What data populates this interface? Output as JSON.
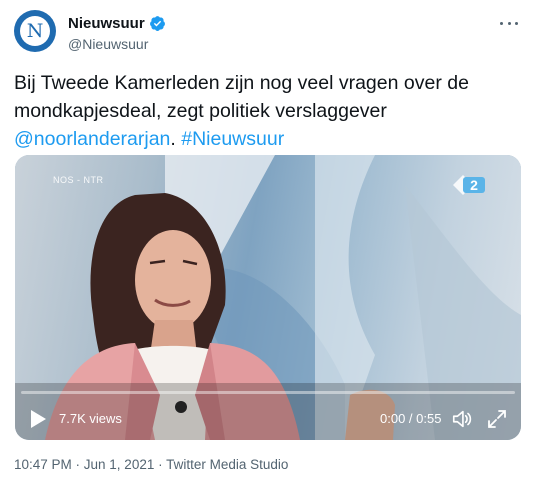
{
  "account": {
    "display_name": "Nieuwsuur",
    "handle": "@Nieuwsuur",
    "avatar_letter": "N",
    "verified": true
  },
  "tweet": {
    "text_plain": "Bij Tweede Kamerleden zijn nog veel vragen over de mondkapjesdeal, zegt politiek verslaggever ",
    "mention": "@noorlanderarjan",
    "separator": ". ",
    "hashtag": "#Nieuwsuur"
  },
  "video": {
    "channel_label": "NOS - NTR",
    "views": "7.7K views",
    "time": "0:00 / 0:55",
    "progress": 0
  },
  "meta": {
    "timestamp": "10:47 PM · Jun 1, 2021 · Twitter Media Studio"
  },
  "colors": {
    "accent": "#1d9bf0",
    "text": "#0f1419",
    "secondary": "#536471",
    "avatar_bg": "#1f6bb0"
  },
  "icons": {
    "verified": "verified-badge-icon",
    "more": "more-icon",
    "play": "play-icon",
    "volume": "volume-icon",
    "fullscreen": "fullscreen-icon",
    "channel": "npo2-logo-icon"
  }
}
